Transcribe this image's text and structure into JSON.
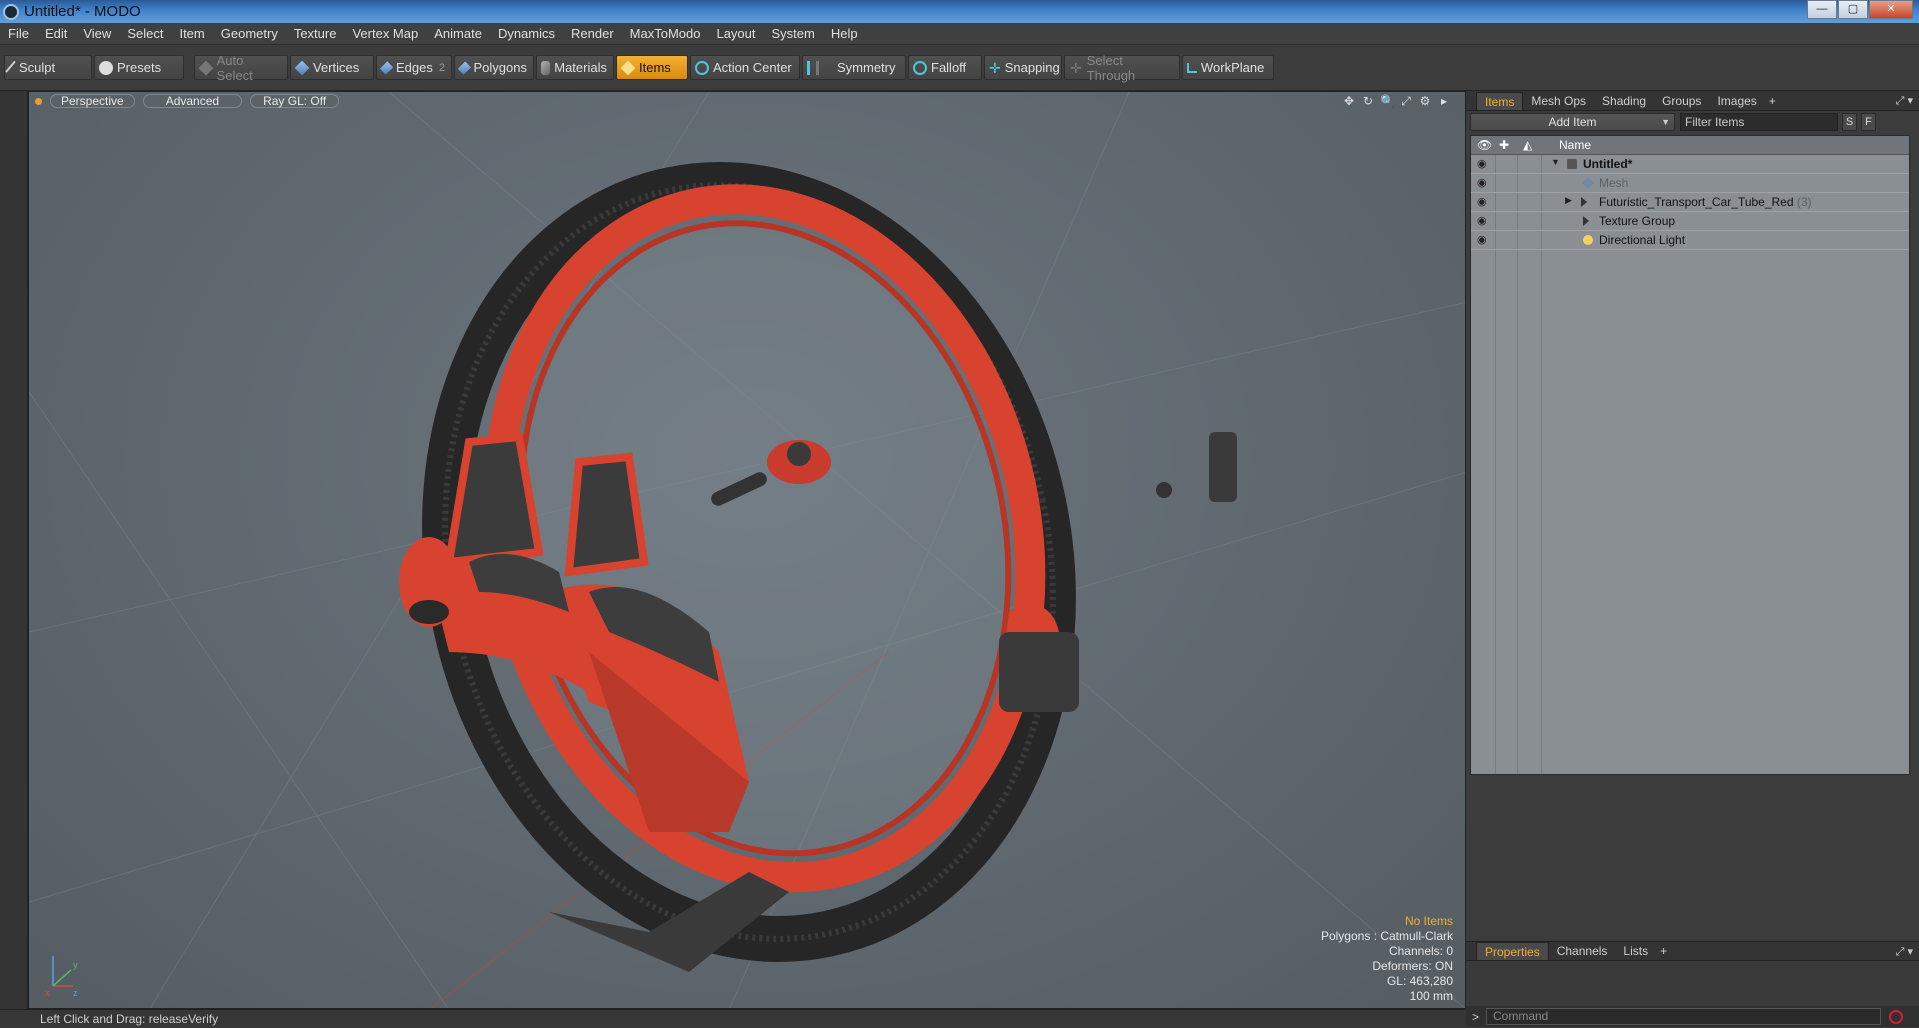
{
  "window": {
    "title": "Untitled* - MODO",
    "controls": [
      "—",
      "▢",
      "✕"
    ]
  },
  "menu": [
    "File",
    "Edit",
    "View",
    "Select",
    "Item",
    "Geometry",
    "Texture",
    "Vertex Map",
    "Animate",
    "Dynamics",
    "Render",
    "MaxToModo",
    "Layout",
    "System",
    "Help"
  ],
  "toolbar": {
    "sculpt": "Sculpt",
    "presets": "Presets",
    "auto_select": "Auto Select",
    "vertices": "Vertices",
    "edges": "Edges",
    "edges_count": "2",
    "polygons": "Polygons",
    "materials": "Materials",
    "items": "Items",
    "action_center": "Action Center",
    "symmetry": "Symmetry",
    "falloff": "Falloff",
    "snapping": "Snapping",
    "select_through": "Select Through",
    "workplane": "WorkPlane"
  },
  "viewport": {
    "view": "Perspective",
    "shading": "Advanced",
    "raygl": "Ray GL: Off",
    "tools": [
      "✥",
      "↻",
      "🔍",
      "⤢",
      "⚙",
      "▸"
    ],
    "info": {
      "selection": "No Items",
      "polygons": "Polygons : Catmull-Clark",
      "channels": "Channels: 0",
      "deformers": "Deformers: ON",
      "gl": "GL: 463,280",
      "scale": "100 mm"
    },
    "axes": {
      "x": "x",
      "y": "y",
      "z": "z"
    }
  },
  "panel": {
    "tabs": [
      "Items",
      "Mesh Ops",
      "Shading",
      "Groups",
      "Images"
    ],
    "plus": "+",
    "add_item": "Add Item",
    "filter_placeholder": "Filter Items",
    "s": "S",
    "f": "F",
    "column_name": "Name",
    "items": [
      {
        "label": "Untitled*",
        "style": "bold",
        "depth": 0,
        "twist": "▼",
        "icon": "scene-icon"
      },
      {
        "label": "Mesh",
        "style": "dim",
        "depth": 1,
        "twist": "",
        "icon": "mesh-icon"
      },
      {
        "label": "Futuristic_Transport_Car_Tube_Red",
        "count": "(3)",
        "style": "normal",
        "depth": 1,
        "twist": "▶",
        "icon": "group-icon"
      },
      {
        "label": "Texture Group",
        "style": "normal",
        "depth": 1,
        "twist": "",
        "icon": "group-icon"
      },
      {
        "label": "Directional Light",
        "style": "normal",
        "depth": 1,
        "twist": "",
        "icon": "light-icon"
      }
    ]
  },
  "bottom_tabs": [
    "Properties",
    "Channels",
    "Lists"
  ],
  "command": {
    "prompt": ">",
    "placeholder": "Command"
  },
  "status": "Left Click and Drag:  releaseVerify",
  "colors": {
    "accent": "#f0b030",
    "body_red": "#d84530",
    "tire": "#2a2a2a",
    "viewport_bg": "#636c73"
  }
}
